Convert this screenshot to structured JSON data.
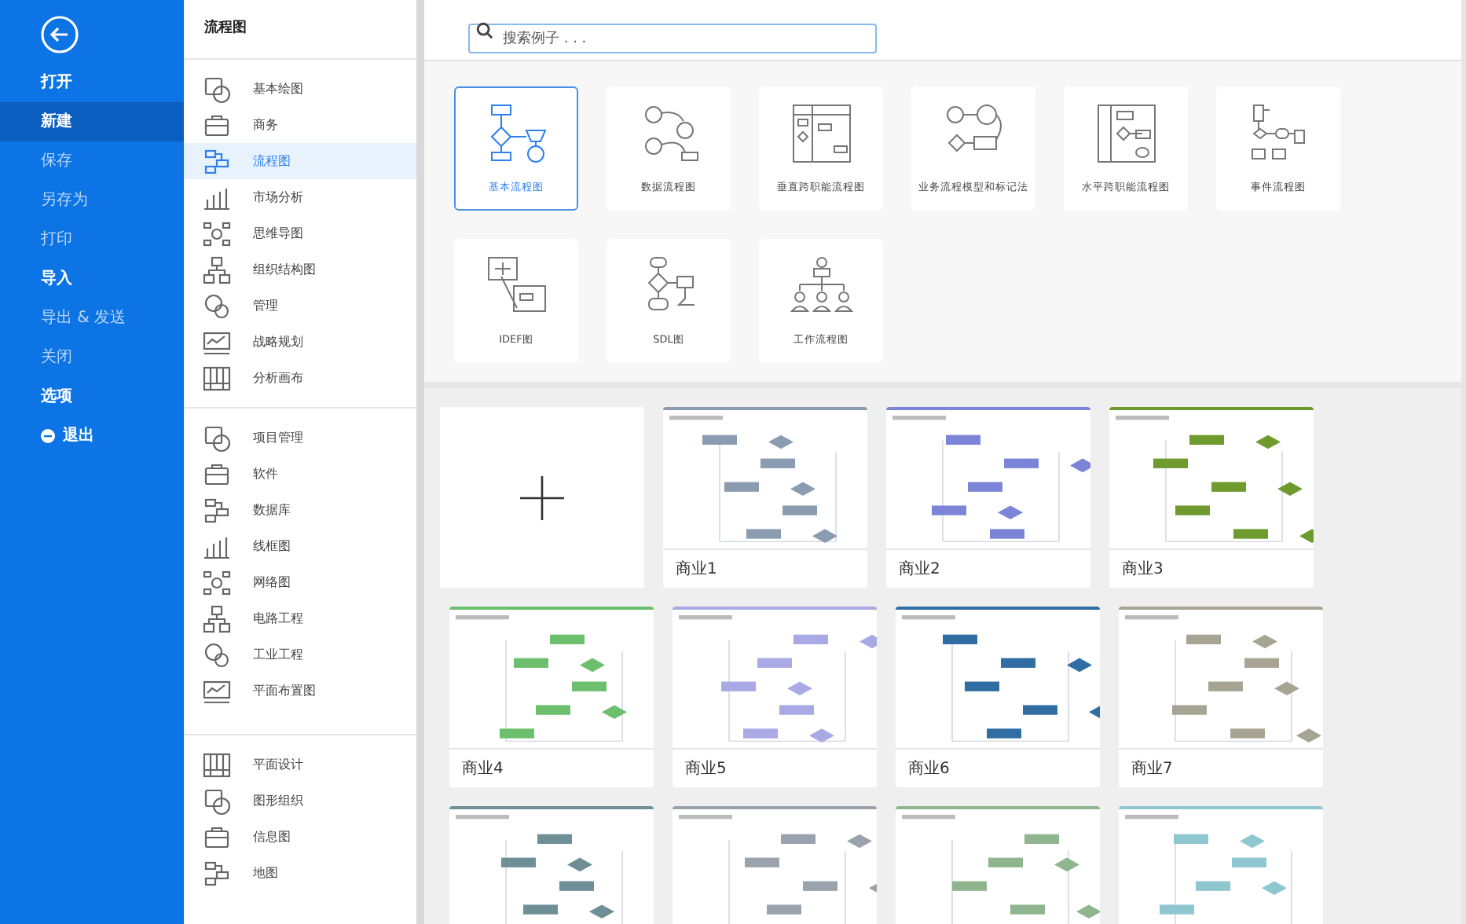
{
  "sidebar": {
    "items": [
      {
        "label": "打开",
        "selected": false,
        "disabled": false,
        "kind": "text"
      },
      {
        "label": "新建",
        "selected": true,
        "disabled": false,
        "kind": "text"
      },
      {
        "label": "保存",
        "selected": false,
        "disabled": true,
        "kind": "text"
      },
      {
        "label": "另存为",
        "selected": false,
        "disabled": true,
        "kind": "text"
      },
      {
        "label": "打印",
        "selected": false,
        "disabled": true,
        "kind": "text"
      },
      {
        "label": "导入",
        "selected": false,
        "disabled": false,
        "kind": "text"
      },
      {
        "label": "导出 & 发送",
        "selected": false,
        "disabled": true,
        "kind": "text"
      },
      {
        "label": "关闭",
        "selected": false,
        "disabled": true,
        "kind": "text"
      },
      {
        "label": "选项",
        "selected": false,
        "disabled": false,
        "kind": "text"
      },
      {
        "label": "退出",
        "selected": false,
        "disabled": false,
        "kind": "exit"
      }
    ]
  },
  "categories": {
    "title": "流程图",
    "groups": [
      [
        {
          "label": "基本绘图",
          "selected": false
        },
        {
          "label": "商务",
          "selected": false
        },
        {
          "label": "流程图",
          "selected": true
        },
        {
          "label": "市场分析",
          "selected": false
        },
        {
          "label": "思维导图",
          "selected": false
        },
        {
          "label": "组织结构图",
          "selected": false
        },
        {
          "label": "管理",
          "selected": false
        },
        {
          "label": "战略规划",
          "selected": false
        },
        {
          "label": "分析画布",
          "selected": false
        }
      ],
      [
        {
          "label": "项目管理",
          "selected": false
        },
        {
          "label": "软件",
          "selected": false
        },
        {
          "label": "数据库",
          "selected": false
        },
        {
          "label": "线框图",
          "selected": false
        },
        {
          "label": "网络图",
          "selected": false
        },
        {
          "label": "电路工程",
          "selected": false
        },
        {
          "label": "工业工程",
          "selected": false
        },
        {
          "label": "平面布置图",
          "selected": false
        }
      ],
      [
        {
          "label": "平面设计",
          "selected": false
        },
        {
          "label": "图形组织",
          "selected": false
        },
        {
          "label": "信息图",
          "selected": false
        },
        {
          "label": "地图",
          "selected": false
        }
      ]
    ]
  },
  "search": {
    "placeholder": "搜索例子 . . ."
  },
  "types": [
    {
      "label": "基本流程图",
      "selected": true
    },
    {
      "label": "数据流程图",
      "selected": false
    },
    {
      "label": "垂直跨职能流程图",
      "selected": false
    },
    {
      "label": "业务流程模型和标记法",
      "selected": false
    },
    {
      "label": "水平跨职能流程图",
      "selected": false
    },
    {
      "label": "事件流程图",
      "selected": false
    },
    {
      "label": "IDEF图",
      "selected": false
    },
    {
      "label": "SDL图",
      "selected": false
    },
    {
      "label": "工作流程图",
      "selected": false
    }
  ],
  "templates": [
    {
      "label": "商业1",
      "color": "#8b9bb0"
    },
    {
      "label": "商业2",
      "color": "#7b84d6"
    },
    {
      "label": "商业3",
      "color": "#6e9a2e"
    },
    {
      "label": "商业4",
      "color": "#6cbf6c"
    },
    {
      "label": "商业5",
      "color": "#a9a9e6"
    },
    {
      "label": "商业6",
      "color": "#2f6da3"
    },
    {
      "label": "商业7",
      "color": "#a8a494"
    },
    {
      "color": "#6f8f96"
    },
    {
      "color": "#9aa3ad"
    },
    {
      "color": "#8fb58f"
    },
    {
      "color": "#8fc7d0"
    }
  ]
}
